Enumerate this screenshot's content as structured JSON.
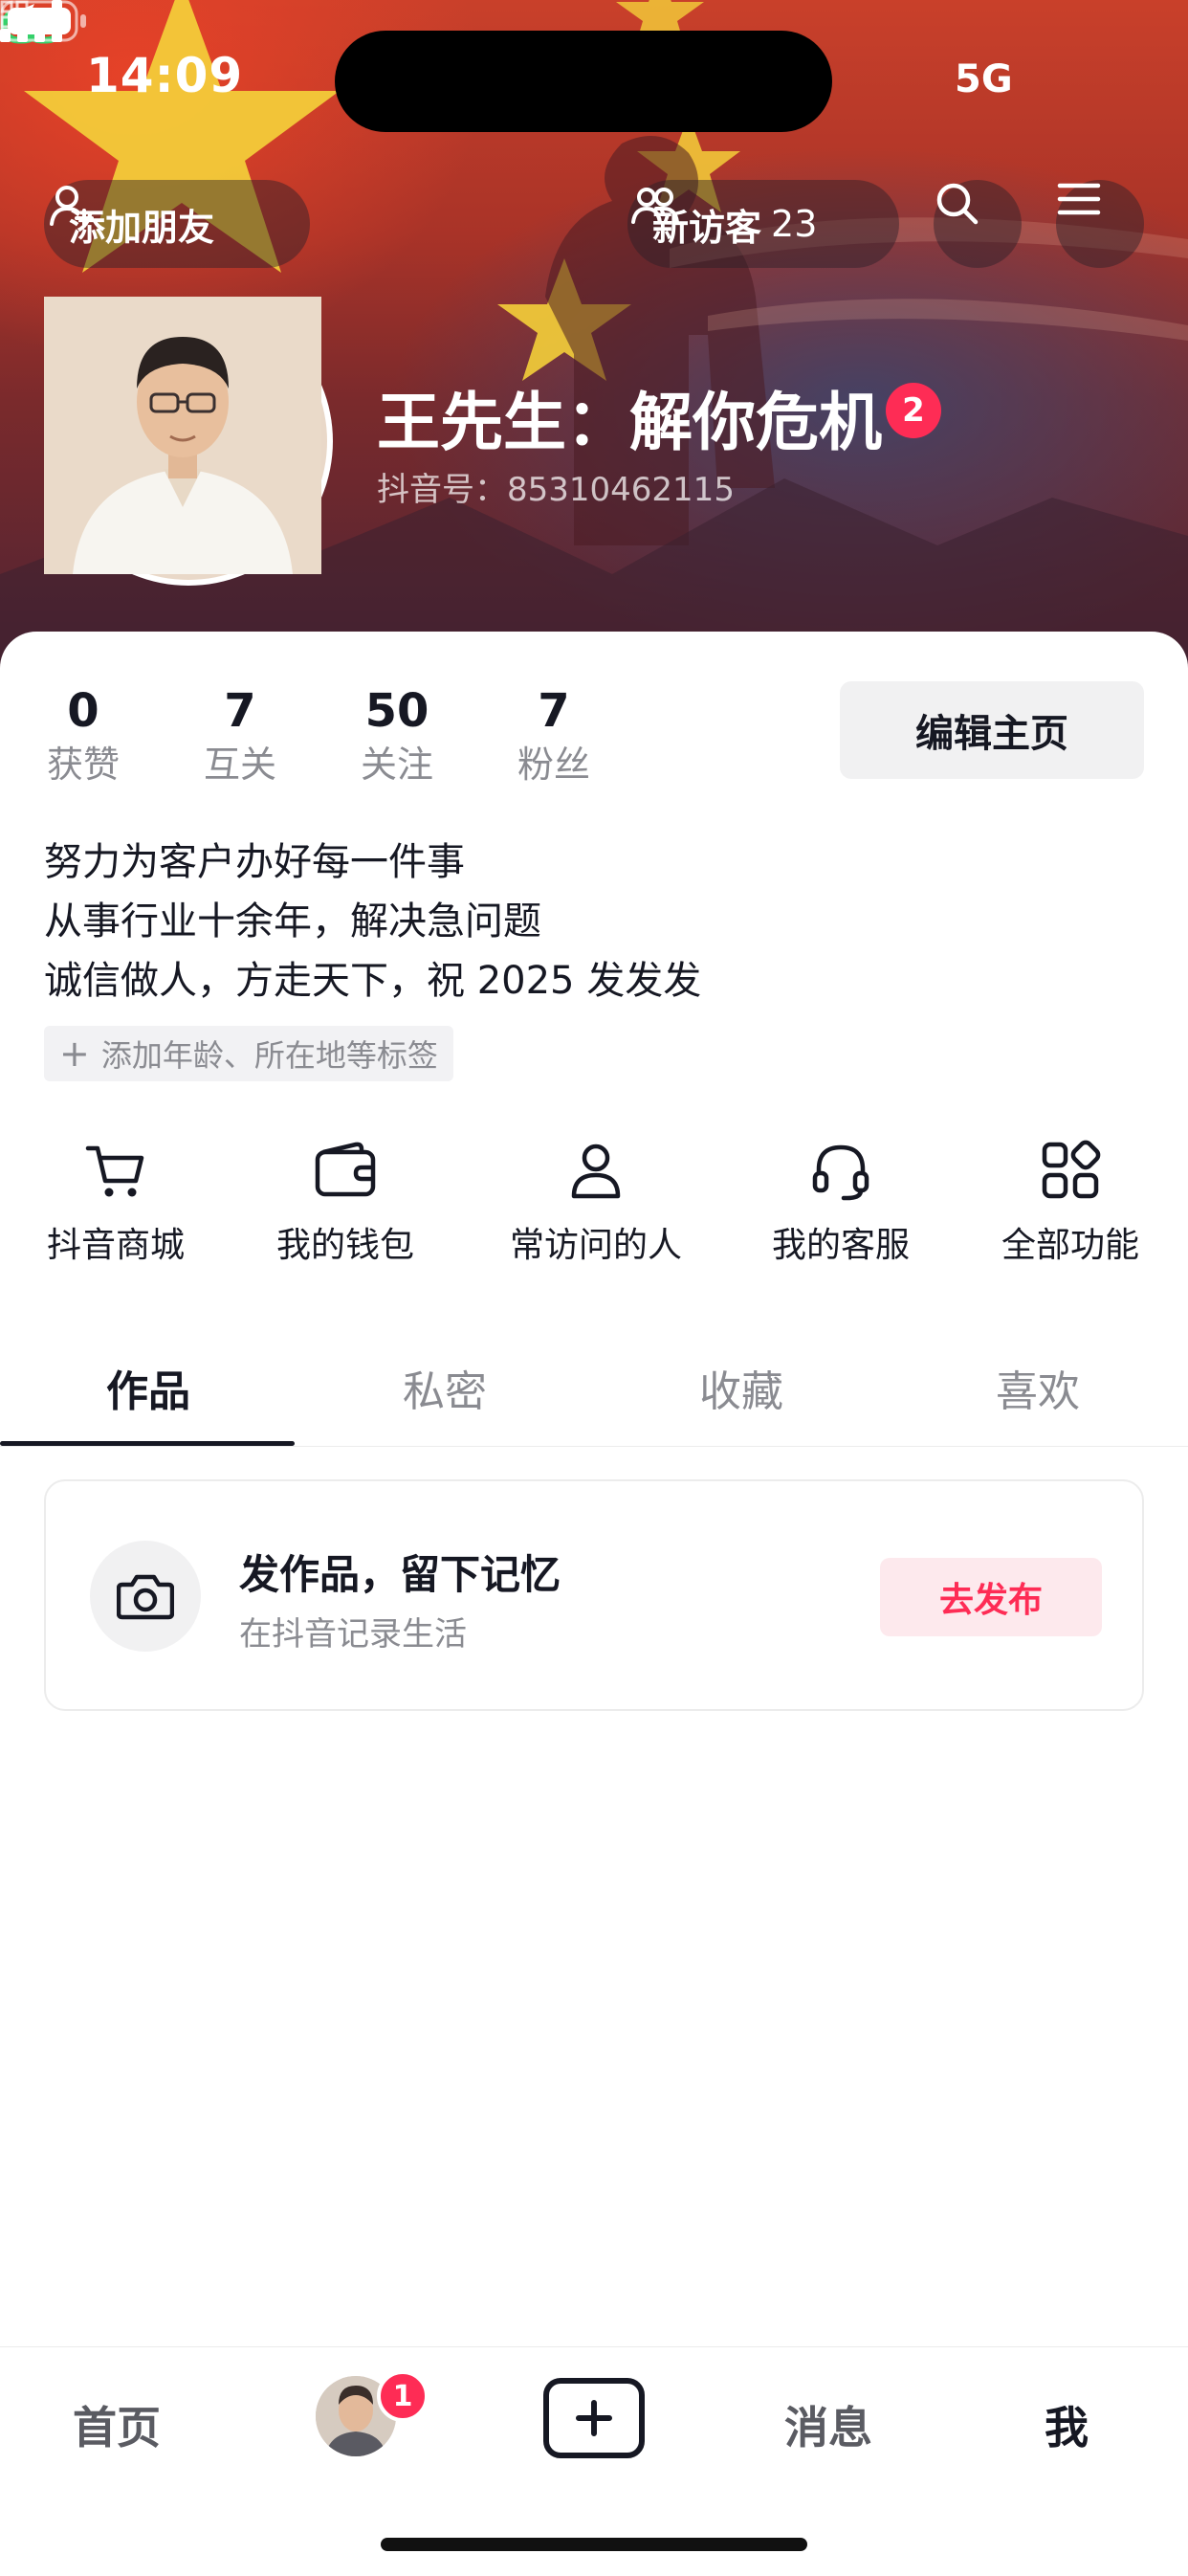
{
  "status_bar": {
    "time": "14:09",
    "network": "5G"
  },
  "top_bar": {
    "add_friend": "添加朋友",
    "new_visitors_label": "新访客",
    "new_visitors_count": "23",
    "search_icon": "search-icon",
    "menu_icon": "menu-icon"
  },
  "profile": {
    "name": "王先生：解你危机",
    "name_badge": "2",
    "douyin_id": "抖音号：85310462115"
  },
  "stats": [
    {
      "value": "0",
      "label": "获赞"
    },
    {
      "value": "7",
      "label": "互关"
    },
    {
      "value": "50",
      "label": "关注"
    },
    {
      "value": "7",
      "label": "粉丝"
    }
  ],
  "edit_button": "编辑主页",
  "bio": {
    "line1": "努力为客户办好每一件事",
    "line2": "从事行业十余年，解决急问题",
    "line3": "诚信做人，方走天下，祝 2025 发发发"
  },
  "add_tags": "添加年龄、所在地等标签",
  "features": [
    {
      "label": "抖音商城",
      "icon": "cart-icon"
    },
    {
      "label": "我的钱包",
      "icon": "wallet-icon"
    },
    {
      "label": "常访问的人",
      "icon": "person-icon"
    },
    {
      "label": "我的客服",
      "icon": "headset-icon"
    },
    {
      "label": "全部功能",
      "icon": "grid-icon"
    }
  ],
  "tabs": [
    {
      "label": "作品",
      "active": true
    },
    {
      "label": "私密",
      "active": false
    },
    {
      "label": "收藏",
      "active": false
    },
    {
      "label": "喜欢",
      "active": false
    }
  ],
  "publish_card": {
    "title": "发作品，留下记忆",
    "subtitle": "在抖音记录生活",
    "button": "去发布"
  },
  "bottom_nav": {
    "home": "首页",
    "friends_badge": "1",
    "messages": "消息",
    "me": "我"
  },
  "colors": {
    "accent": "#fe2c55",
    "text_primary": "#161823",
    "text_secondary": "#8a8b91"
  }
}
